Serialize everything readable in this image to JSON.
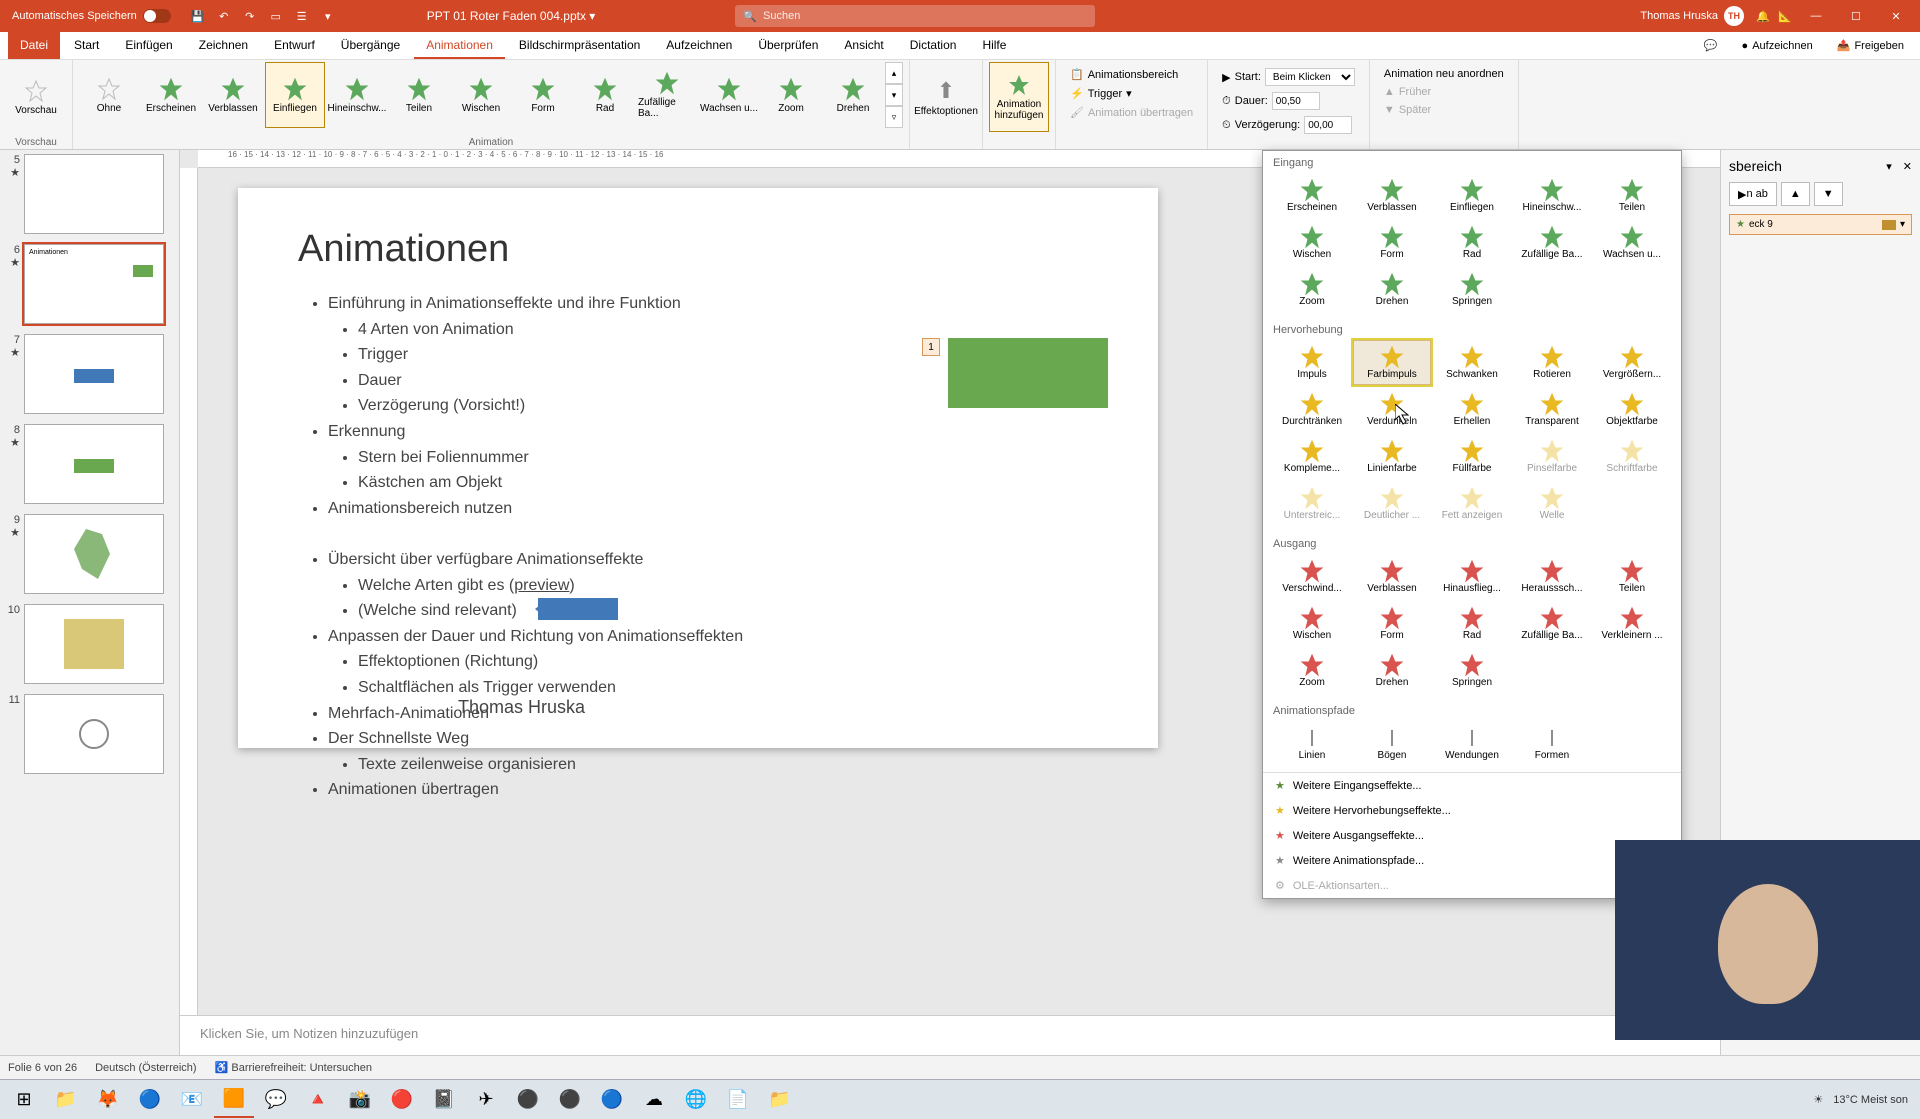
{
  "titlebar": {
    "auto_save": "Automatisches Speichern",
    "filename": "PPT 01 Roter Faden 004.pptx",
    "search_placeholder": "Suchen",
    "user_name": "Thomas Hruska",
    "user_initials": "TH"
  },
  "tabs": {
    "file": "Datei",
    "items": [
      "Start",
      "Einfügen",
      "Zeichnen",
      "Entwurf",
      "Übergänge",
      "Animationen",
      "Bildschirmpräsentation",
      "Aufzeichnen",
      "Überprüfen",
      "Ansicht",
      "Dictation",
      "Hilfe"
    ],
    "active_index": 5,
    "record": "Aufzeichnen",
    "share": "Freigeben"
  },
  "ribbon": {
    "preview": "Vorschau",
    "gallery": [
      "Ohne",
      "Erscheinen",
      "Verblassen",
      "Einfliegen",
      "Hineinschw...",
      "Teilen",
      "Wischen",
      "Form",
      "Rad",
      "Zufällige Ba...",
      "Wachsen u...",
      "Zoom",
      "Drehen"
    ],
    "gallery_selected": 3,
    "effect_options": "Effektoptionen",
    "animation_group": "Animation",
    "add_animation": "Animation hinzufügen",
    "anim_pane": "Animationsbereich",
    "trigger": "Trigger",
    "copy_anim": "Animation übertragen",
    "start_label": "Start:",
    "start_value": "Beim Klicken",
    "duration_label": "Dauer:",
    "duration_value": "00,50",
    "delay_label": "Verzögerung:",
    "delay_value": "00,00",
    "reorder": "Animation neu anordnen",
    "earlier": "Früher",
    "later": "Später"
  },
  "dropdown": {
    "eingang": {
      "title": "Eingang",
      "items": [
        "Erscheinen",
        "Verblassen",
        "Einfliegen",
        "Hineinschw...",
        "Teilen",
        "Wischen",
        "Form",
        "Rad",
        "Zufällige Ba...",
        "Wachsen u...",
        "Zoom",
        "Drehen",
        "Springen"
      ]
    },
    "hervorhebung": {
      "title": "Hervorhebung",
      "items": [
        "Impuls",
        "Farbimpuls",
        "Schwanken",
        "Rotieren",
        "Vergrößern...",
        "Durchtränken",
        "Verdunkeln",
        "Erhellen",
        "Transparent",
        "Objektfarbe",
        "Kompleme...",
        "Linienfarbe",
        "Füllfarbe",
        "Pinselfarbe",
        "Schriftfarbe",
        "Unterstreic...",
        "Deutlicher ...",
        "Fett anzeigen",
        "Welle"
      ],
      "disabled": [
        13,
        14,
        15,
        16,
        17,
        18
      ],
      "hovered": 1
    },
    "ausgang": {
      "title": "Ausgang",
      "items": [
        "Verschwind...",
        "Verblassen",
        "Hinausflieg...",
        "Herausssch...",
        "Teilen",
        "Wischen",
        "Form",
        "Rad",
        "Zufällige Ba...",
        "Verkleinern ...",
        "Zoom",
        "Drehen",
        "Springen"
      ]
    },
    "pfade": {
      "title": "Animationspfade",
      "items": [
        "Linien",
        "Bögen",
        "Wendungen",
        "Formen"
      ]
    },
    "more": [
      "Weitere Eingangseffekte...",
      "Weitere Hervorhebungseffekte...",
      "Weitere Ausgangseffekte...",
      "Weitere Animationspfade...",
      "OLE-Aktionsarten..."
    ]
  },
  "slides": {
    "visible": [
      5,
      6,
      7,
      8,
      9,
      10,
      11
    ],
    "active": 6
  },
  "slide": {
    "title": "Animationen",
    "bullets_html": "<ul><li>Einführung in Animationseffekte und ihre Funktion<ul><li>4 Arten von Animation</li><li>Trigger</li><li>Dauer</li><li>Verzögerung (Vorsicht!)</li></ul></li><li>Erkennung<ul><li>Stern bei Foliennummer</li><li>Kästchen am Objekt</li></ul></li><li>Animationsbereich nutzen</li></ul><br><ul><li>Übersicht über verfügbare Animationseffekte<ul><li>Welche Arten gibt es (<u>preview</u>)</li><li>(Welche sind relevant)</li></ul></li><li>Anpassen der Dauer und Richtung von Animationseffekten<ul><li>Effektoptionen (Richtung)</li><li>Schaltflächen als Trigger verwenden</li></ul></li><li>Mehrfach-Animationen</li><li>Der Schnellste Weg<ul><li>Texte zeilenweise organisieren</li></ul></li><li>Animationen übertragen</li></ul>",
    "author": "Thomas Hruska",
    "anim_tag": "1"
  },
  "notes_placeholder": "Klicken Sie, um Notizen hinzuzufügen",
  "anim_pane": {
    "title": "sbereich",
    "play": "n ab",
    "item": "eck 9"
  },
  "statusbar": {
    "slide_info": "Folie 6 von 26",
    "language": "Deutsch (Österreich)",
    "accessibility": "Barrierefreiheit: Untersuchen"
  },
  "taskbar": {
    "weather": "13°C  Meist son"
  }
}
